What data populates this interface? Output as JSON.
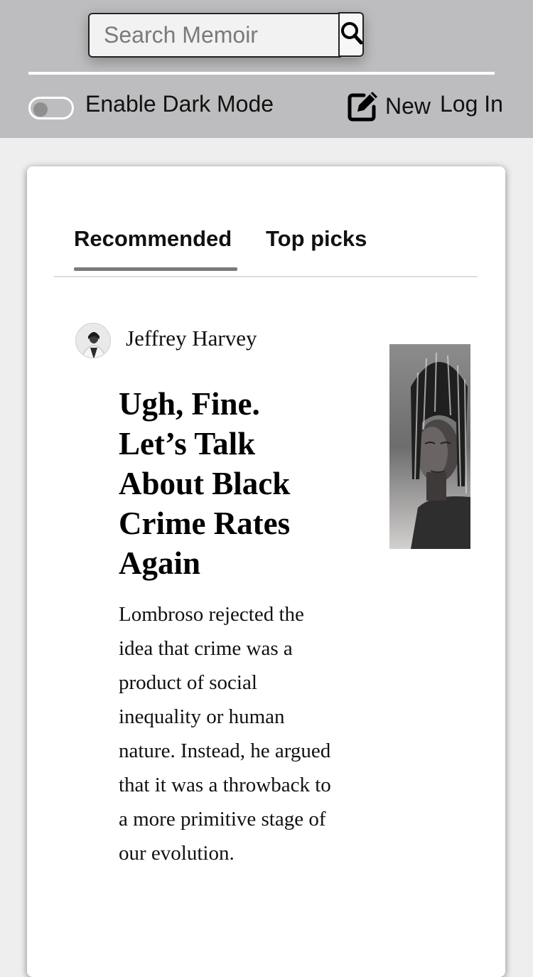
{
  "search": {
    "placeholder": "Search Memoir",
    "icon": "search-icon"
  },
  "header": {
    "dark_mode_label": "Enable Dark Mode",
    "dark_mode_enabled": false,
    "new_label": "New",
    "new_icon": "edit-icon",
    "login_label": "Log In"
  },
  "tabs": [
    {
      "label": "Recommended",
      "active": true
    },
    {
      "label": "Top picks",
      "active": false
    }
  ],
  "article": {
    "author": "Jeffrey Harvey",
    "title": "Ugh, Fine. Let’s Talk About Black Crime Rates Again",
    "excerpt": "Lombroso rejected the idea that crime was a product of social inequality or human nature. Instead, he argued that it was a throwback to a more primitive stage of our evolution."
  },
  "colors": {
    "topbar": "#bdbdbf",
    "page_bg": "#eeeeee",
    "card_bg": "#ffffff",
    "tab_underline": "#7a7a7a"
  }
}
